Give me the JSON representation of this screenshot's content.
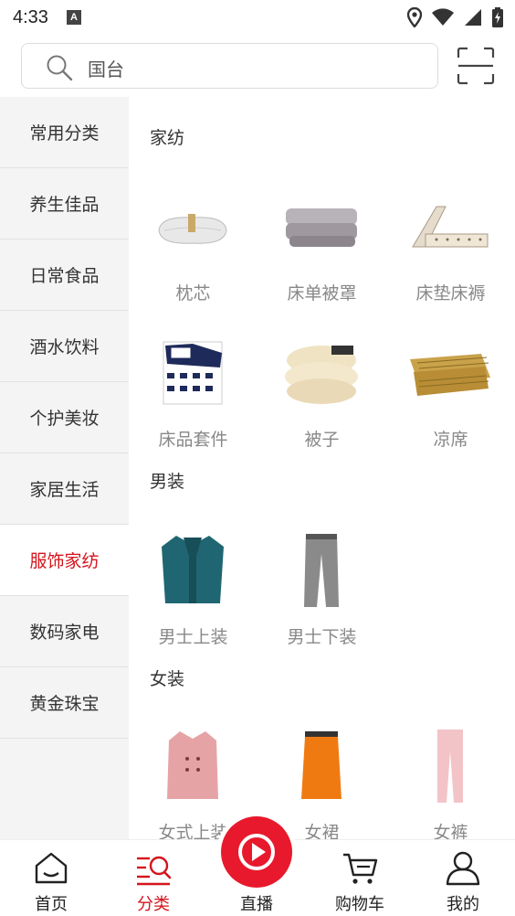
{
  "status_bar": {
    "time": "4:33",
    "notification_letter": "A"
  },
  "search": {
    "placeholder": "国台"
  },
  "sidebar": {
    "active_index": 6,
    "items": [
      {
        "label": "常用分类"
      },
      {
        "label": "养生佳品"
      },
      {
        "label": "日常食品"
      },
      {
        "label": "酒水饮料"
      },
      {
        "label": "个护美妆"
      },
      {
        "label": "家居生活"
      },
      {
        "label": "服饰家纺"
      },
      {
        "label": "数码家电"
      },
      {
        "label": "黄金珠宝"
      }
    ]
  },
  "sections": [
    {
      "title": "家纺",
      "items": [
        {
          "label": "枕芯",
          "icon": "pillow-image"
        },
        {
          "label": "床单被罩",
          "icon": "bedsheet-image"
        },
        {
          "label": "床垫床褥",
          "icon": "mattress-image"
        },
        {
          "label": "床品套件",
          "icon": "bedding-set-image"
        },
        {
          "label": "被子",
          "icon": "quilt-image"
        },
        {
          "label": "凉席",
          "icon": "summer-mat-image"
        }
      ]
    },
    {
      "title": "男装",
      "items": [
        {
          "label": "男士上装",
          "icon": "mens-jacket-image"
        },
        {
          "label": "男士下装",
          "icon": "mens-pants-image"
        }
      ]
    },
    {
      "title": "女装",
      "items": [
        {
          "label": "女式上装",
          "icon": "womens-coat-image"
        },
        {
          "label": "女裙",
          "icon": "skirt-image"
        },
        {
          "label": "女裤",
          "icon": "womens-pants-image"
        }
      ]
    }
  ],
  "bottom_nav": {
    "active_index": 1,
    "items": [
      {
        "label": "首页",
        "icon": "home-icon"
      },
      {
        "label": "分类",
        "icon": "category-search-icon"
      },
      {
        "label": "直播",
        "icon": "live-play-icon"
      },
      {
        "label": "购物车",
        "icon": "cart-icon"
      },
      {
        "label": "我的",
        "icon": "profile-icon"
      }
    ]
  },
  "colors": {
    "accent": "#d4141c",
    "live": "#e8192c",
    "sidebar_bg": "#f4f4f4"
  }
}
